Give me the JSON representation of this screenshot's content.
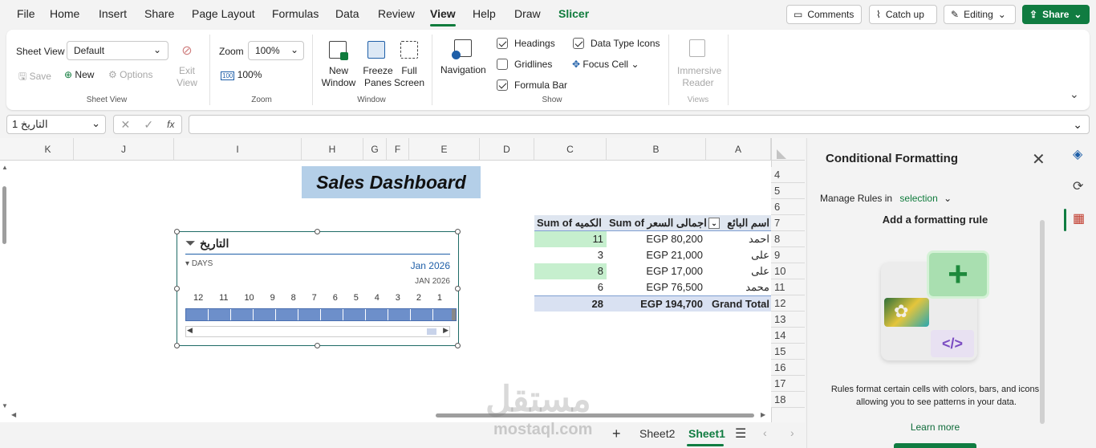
{
  "menu": {
    "items": [
      "File",
      "Home",
      "Insert",
      "Share",
      "Page Layout",
      "Formulas",
      "Data",
      "Review",
      "View",
      "Help",
      "Draw",
      "Slicer"
    ],
    "active": "View"
  },
  "topbar": {
    "comments": "Comments",
    "catchup": "Catch up",
    "editing": "Editing",
    "share": "Share"
  },
  "ribbon": {
    "sheetview": {
      "label": "Sheet View",
      "dropdown_value": "Default",
      "save": "Save",
      "new": "New",
      "options": "Options",
      "exit_view": "Exit View",
      "group": "Sheet View"
    },
    "zoom": {
      "label": "Zoom",
      "value": "100%",
      "hundred": "100%",
      "group": "Zoom"
    },
    "window": {
      "new_window": "New Window",
      "freeze_panes": "Freeze Panes",
      "full_screen": "Full Screen",
      "group": "Window"
    },
    "show": {
      "navigation": "Navigation",
      "headings": "Headings",
      "gridlines": "Gridlines",
      "formula_bar": "Formula Bar",
      "data_type_icons": "Data Type Icons",
      "focus_cell": "Focus Cell",
      "group": "Show"
    },
    "views": {
      "immersive_reader": "Immersive Reader",
      "group": "Views"
    }
  },
  "formula": {
    "namebox": "التاريخ 1",
    "fx": "fx",
    "content": ""
  },
  "columns": [
    "K",
    "J",
    "I",
    "H",
    "G",
    "F",
    "E",
    "D",
    "C",
    "B",
    "A"
  ],
  "rows": [
    "4",
    "5",
    "6",
    "7",
    "8",
    "9",
    "10",
    "11",
    "12",
    "13",
    "14",
    "15",
    "16",
    "17",
    "18"
  ],
  "dashboard_title": "Sales Dashboard",
  "pivot": {
    "headers": [
      "Sum of الكميه",
      "Sum of اجمالى السعر",
      "اسم البائع"
    ],
    "rows": [
      {
        "qty": "11",
        "total": "EGP 80,200",
        "name": "احمد"
      },
      {
        "qty": "3",
        "total": "EGP 21,000",
        "name": "على"
      },
      {
        "qty": "8",
        "total": "EGP 17,000",
        "name": "على"
      },
      {
        "qty": "6",
        "total": "EGP 76,500",
        "name": "محمد"
      }
    ],
    "grand": {
      "qty": "28",
      "total": "EGP 194,700",
      "label": "Grand Total"
    }
  },
  "timeline": {
    "title": "التاريخ",
    "level": "DAYS",
    "period": "Jan 2026",
    "month": "JAN 2026",
    "days": [
      "12",
      "11",
      "10",
      "9",
      "8",
      "7",
      "6",
      "5",
      "4",
      "3",
      "2",
      "1"
    ]
  },
  "taskpane": {
    "title": "Conditional Formatting",
    "manage_label": "Manage Rules in",
    "manage_value": "selection",
    "add_rule": "Add a formatting rule",
    "description": "Rules format certain cells with colors, bars, and icons, allowing you to see patterns in your data.",
    "learn_more": "Learn more"
  },
  "sheets": {
    "tabs": [
      "Sheet2",
      "Sheet1"
    ],
    "active": "Sheet1"
  },
  "watermark": {
    "arabic": "مستقل",
    "latin": "mostaql.com"
  },
  "colors": {
    "accent": "#0f7b3c",
    "selected_tab": "#107c41",
    "pivot_highlight": "#c6efce",
    "pivot_total": "#d9e1f2",
    "title_bg": "#b4cfe8"
  }
}
